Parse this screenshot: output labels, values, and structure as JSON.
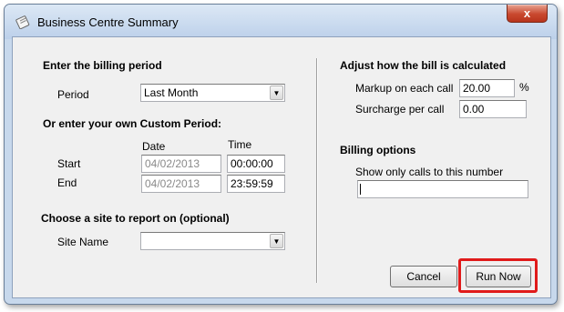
{
  "window": {
    "title": "Business Centre Summary",
    "close_label": "x"
  },
  "billing_period": {
    "heading": "Enter the billing period",
    "period_label": "Period",
    "period_value": "Last Month"
  },
  "custom_period": {
    "heading": "Or enter your own Custom Period:",
    "date_header": "Date",
    "time_header": "Time",
    "start_label": "Start",
    "start_date": "04/02/2013",
    "start_time": "00:00:00",
    "end_label": "End",
    "end_date": "04/02/2013",
    "end_time": "23:59:59"
  },
  "site": {
    "heading": "Choose a site to report on (optional)",
    "site_label": "Site Name",
    "site_value": ""
  },
  "bill_calc": {
    "heading": "Adjust how the bill is calculated",
    "markup_label": "Markup on each call",
    "markup_value": "20.00",
    "markup_unit": "%",
    "surcharge_label": "Surcharge per call",
    "surcharge_value": "0.00"
  },
  "billing_options": {
    "heading": "Billing options",
    "number_label": "Show only calls to this number",
    "number_value": ""
  },
  "buttons": {
    "cancel_label": "Cancel",
    "run_label": "Run Now"
  },
  "colors": {
    "highlight": "#e01b1b",
    "close_button": "#c9492f"
  }
}
